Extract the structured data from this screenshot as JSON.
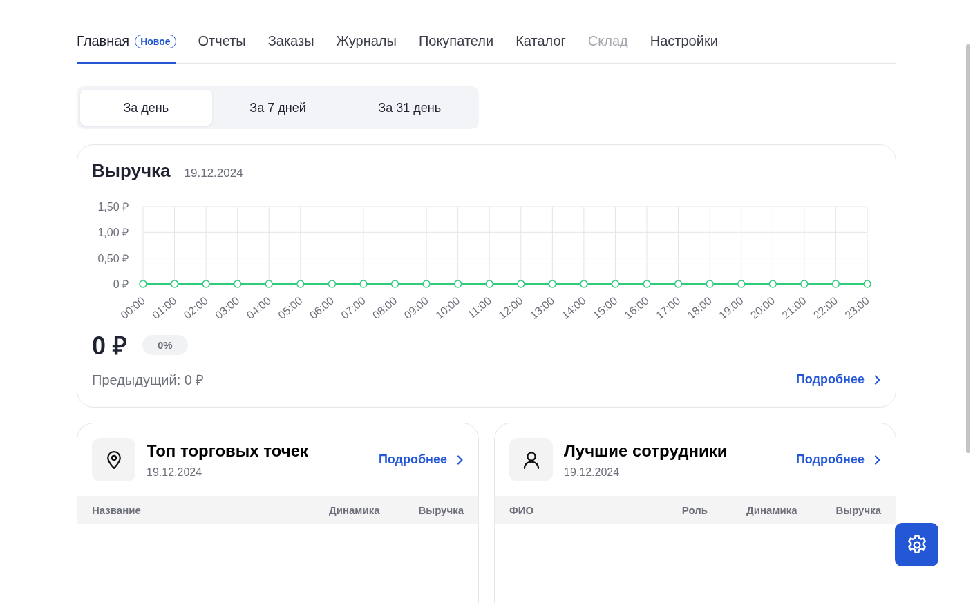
{
  "tabs": [
    {
      "label": "Главная",
      "badge": "Новое",
      "selected": true,
      "disabled": false
    },
    {
      "label": "Отчеты",
      "selected": false,
      "disabled": false
    },
    {
      "label": "Заказы",
      "selected": false,
      "disabled": false
    },
    {
      "label": "Журналы",
      "selected": false,
      "disabled": false
    },
    {
      "label": "Покупатели",
      "selected": false,
      "disabled": false
    },
    {
      "label": "Каталог",
      "selected": false,
      "disabled": false
    },
    {
      "label": "Склад",
      "selected": false,
      "disabled": true
    },
    {
      "label": "Настройки",
      "selected": false,
      "disabled": false
    }
  ],
  "periods": [
    {
      "label": "За день",
      "selected": true
    },
    {
      "label": "За 7 дней",
      "selected": false
    },
    {
      "label": "За 31 день",
      "selected": false
    }
  ],
  "revenue": {
    "title": "Выручка",
    "date": "19.12.2024",
    "chart_data": {
      "type": "line",
      "categories": [
        "00:00",
        "01:00",
        "02:00",
        "03:00",
        "04:00",
        "05:00",
        "06:00",
        "07:00",
        "08:00",
        "09:00",
        "10:00",
        "11:00",
        "12:00",
        "13:00",
        "14:00",
        "15:00",
        "16:00",
        "17:00",
        "18:00",
        "19:00",
        "20:00",
        "21:00",
        "22:00",
        "23:00"
      ],
      "series": [
        {
          "color": "#2ecc7a",
          "marker": "circle",
          "values": [
            0,
            0,
            0,
            0,
            0,
            0,
            0,
            0,
            0,
            0,
            0,
            0,
            0,
            0,
            0,
            0,
            0,
            0,
            0,
            0,
            0,
            0,
            0,
            0
          ]
        }
      ],
      "ylim": [
        0,
        1.5
      ],
      "yticks": [
        {
          "value": 0,
          "label": "0 ₽"
        },
        {
          "value": 0.5,
          "label": "0,50 ₽"
        },
        {
          "value": 1,
          "label": "1,00 ₽"
        },
        {
          "value": 1.5,
          "label": "1,50 ₽"
        }
      ]
    },
    "total": "0 ₽",
    "change": "0%",
    "previous": "Предыдущий: 0 ₽",
    "more_link": "Подробнее"
  },
  "panels": [
    {
      "kind": "location",
      "title": "Топ торговых точек",
      "date": "19.12.2024",
      "more_link": "Подробнее",
      "columns": [
        "Название",
        "Динамика",
        "Выручка"
      ]
    },
    {
      "kind": "person",
      "title": "Лучшие сотрудники",
      "date": "19.12.2024",
      "more_link": "Подробнее",
      "columns": [
        "ФИО",
        "Роль",
        "Динамика",
        "Выручка"
      ]
    }
  ]
}
